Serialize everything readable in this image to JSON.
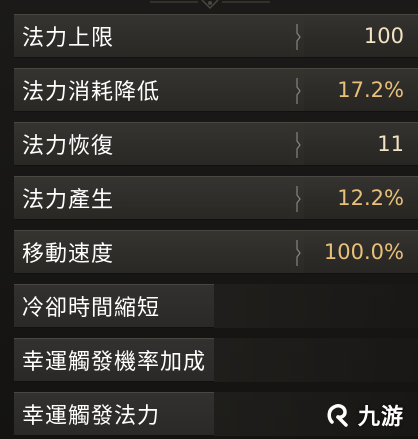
{
  "stats": [
    {
      "name": "法力上限",
      "value": "100"
    },
    {
      "name": "法力消耗降低",
      "value": "17.2%"
    },
    {
      "name": "法力恢復",
      "value": "11"
    },
    {
      "name": "法力產生",
      "value": "12.2%"
    },
    {
      "name": "移動速度",
      "value": "100.0%"
    }
  ],
  "locked_stats": [
    {
      "name": "冷卻時間縮短"
    },
    {
      "name": "幸運觸發機率加成"
    },
    {
      "name": "幸運觸發法力"
    }
  ],
  "watermark": {
    "text": "九游",
    "icon": "jiuyou-logo-icon"
  },
  "colors": {
    "value_gold": "#e8c07a",
    "row_bg": "#302e2b",
    "background": "#151412"
  }
}
